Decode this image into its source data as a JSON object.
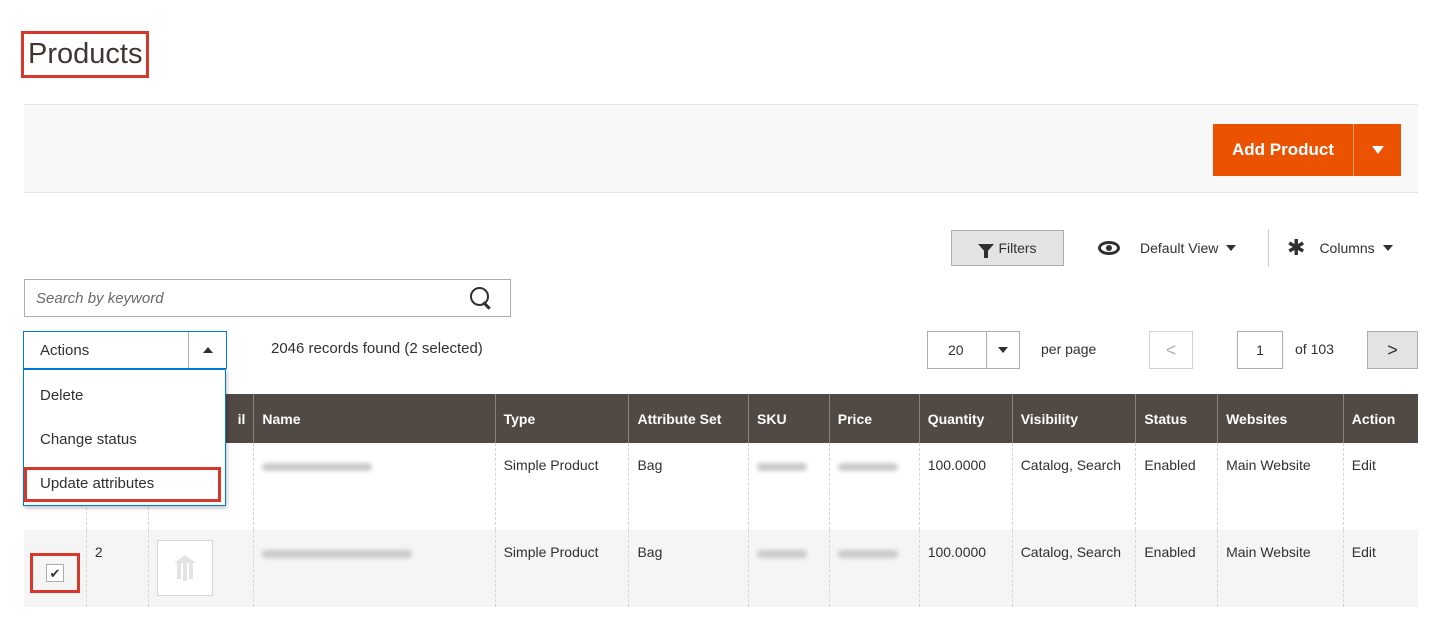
{
  "page": {
    "title": "Products"
  },
  "header": {
    "add_product_label": "Add Product"
  },
  "toolbar": {
    "filters_label": "Filters",
    "default_view_label": "Default View",
    "columns_label": "Columns"
  },
  "search": {
    "placeholder": "Search by keyword"
  },
  "actions": {
    "label": "Actions",
    "items": [
      "Delete",
      "Change status",
      "Update attributes"
    ]
  },
  "records_text": "2046 records found (2 selected)",
  "pagination": {
    "per_page_value": "20",
    "per_page_label": "per page",
    "prev_glyph": "<",
    "next_glyph": ">",
    "current_page": "1",
    "total_pages_text": "of 103"
  },
  "table": {
    "headers": {
      "thumbnail": "il",
      "name": "Name",
      "type": "Type",
      "attribute_set": "Attribute Set",
      "sku": "SKU",
      "price": "Price",
      "quantity": "Quantity",
      "visibility": "Visibility",
      "status": "Status",
      "websites": "Websites",
      "action": "Action"
    },
    "rows": [
      {
        "id": "",
        "type": "Simple Product",
        "attribute_set": "Bag",
        "quantity": "100.0000",
        "visibility": "Catalog, Search",
        "status": "Enabled",
        "websites": "Main Website",
        "action": "Edit"
      },
      {
        "id": "2",
        "type": "Simple Product",
        "attribute_set": "Bag",
        "quantity": "100.0000",
        "visibility": "Catalog, Search",
        "status": "Enabled",
        "websites": "Main Website",
        "action": "Edit"
      }
    ]
  },
  "colors": {
    "accent": "#eb5202",
    "table_header": "#514943",
    "highlight": "#d8382c",
    "link": "#007bdb"
  }
}
